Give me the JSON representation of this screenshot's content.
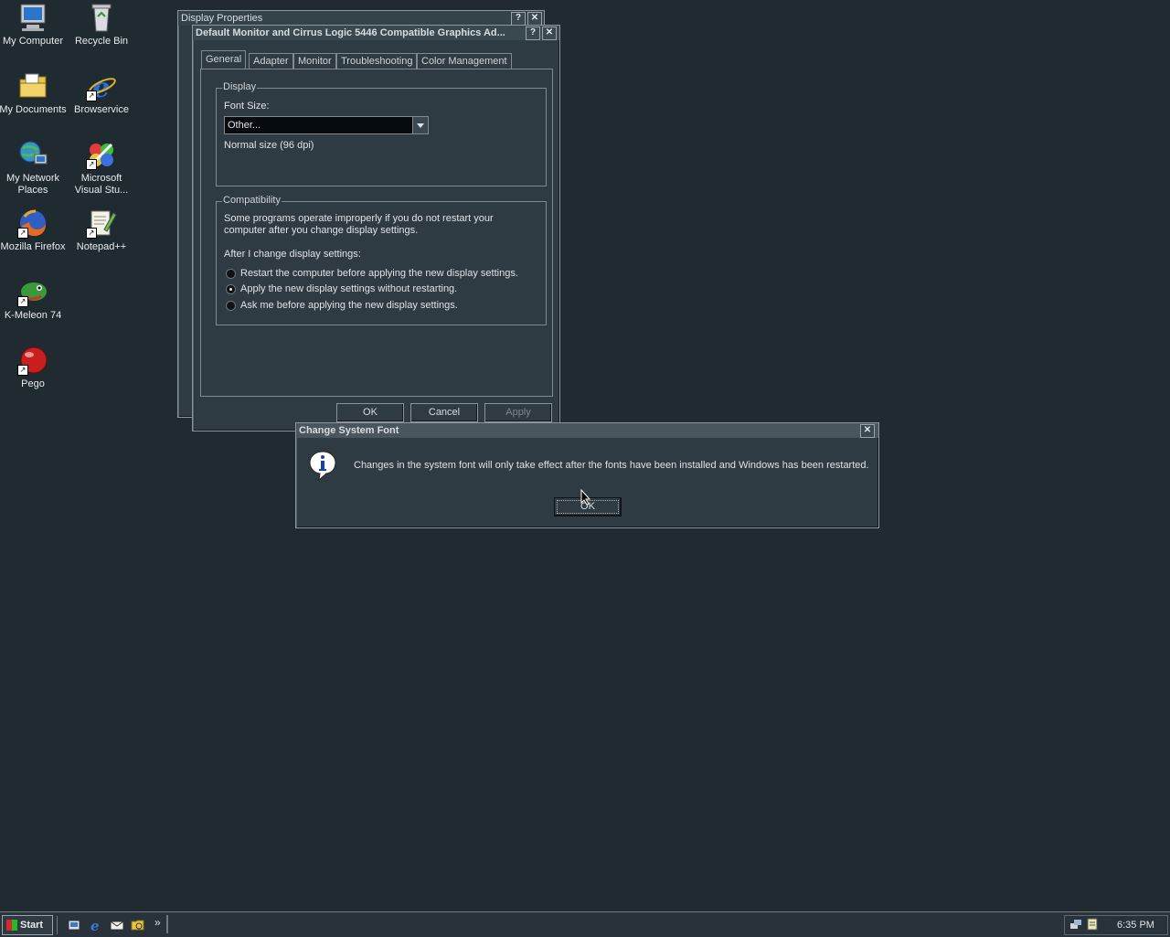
{
  "desktop": {
    "icons": [
      {
        "label": "My Computer"
      },
      {
        "label": "Recycle Bin"
      },
      {
        "label": "My Documents"
      },
      {
        "label": "Browservice"
      },
      {
        "label": "My Network Places"
      },
      {
        "label": "Microsoft Visual Stu..."
      },
      {
        "label": "Mozilla Firefox"
      },
      {
        "label": "Notepad++"
      },
      {
        "label": "K-Meleon 74"
      },
      {
        "label": "Pego"
      }
    ]
  },
  "display_properties": {
    "title": "Display Properties"
  },
  "adapter_dialog": {
    "title": "Default Monitor and Cirrus Logic 5446 Compatible Graphics Ad...",
    "help_btn": "?",
    "close_btn": "✕",
    "tabs": [
      "General",
      "Adapter",
      "Monitor",
      "Troubleshooting",
      "Color Management"
    ],
    "display_group": {
      "label": "Display",
      "font_size_label": "Font Size:",
      "font_size_value": "Other...",
      "dpi_text": "Normal size (96 dpi)"
    },
    "compat_group": {
      "label": "Compatibility",
      "description": "Some programs operate improperly if you do not restart your computer after you change display settings.",
      "after_label": "After I change display settings:",
      "options": [
        {
          "label": "Restart the computer before applying the new display settings.",
          "selected": false
        },
        {
          "label": "Apply the new display settings without restarting.",
          "selected": true
        },
        {
          "label": "Ask me before applying the new display settings.",
          "selected": false
        }
      ]
    },
    "buttons": {
      "ok": "OK",
      "cancel": "Cancel",
      "apply": "Apply"
    }
  },
  "message_box": {
    "title": "Change System Font",
    "close_btn": "✕",
    "message": "Changes in the system font will only take effect after the fonts have been installed and Windows has been restarted.",
    "ok": "OK"
  },
  "taskbar": {
    "start_label": "Start",
    "chevron": "»",
    "clock": "6:35 PM"
  }
}
